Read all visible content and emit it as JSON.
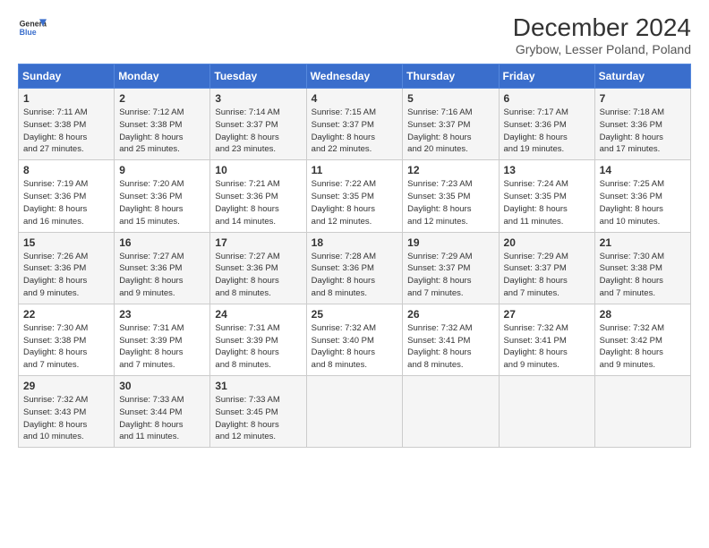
{
  "header": {
    "title": "December 2024",
    "subtitle": "Grybow, Lesser Poland, Poland"
  },
  "days": [
    "Sunday",
    "Monday",
    "Tuesday",
    "Wednesday",
    "Thursday",
    "Friday",
    "Saturday"
  ],
  "weeks": [
    [
      {
        "num": "1",
        "detail": "Sunrise: 7:11 AM\nSunset: 3:38 PM\nDaylight: 8 hours\nand 27 minutes."
      },
      {
        "num": "2",
        "detail": "Sunrise: 7:12 AM\nSunset: 3:38 PM\nDaylight: 8 hours\nand 25 minutes."
      },
      {
        "num": "3",
        "detail": "Sunrise: 7:14 AM\nSunset: 3:37 PM\nDaylight: 8 hours\nand 23 minutes."
      },
      {
        "num": "4",
        "detail": "Sunrise: 7:15 AM\nSunset: 3:37 PM\nDaylight: 8 hours\nand 22 minutes."
      },
      {
        "num": "5",
        "detail": "Sunrise: 7:16 AM\nSunset: 3:37 PM\nDaylight: 8 hours\nand 20 minutes."
      },
      {
        "num": "6",
        "detail": "Sunrise: 7:17 AM\nSunset: 3:36 PM\nDaylight: 8 hours\nand 19 minutes."
      },
      {
        "num": "7",
        "detail": "Sunrise: 7:18 AM\nSunset: 3:36 PM\nDaylight: 8 hours\nand 17 minutes."
      }
    ],
    [
      {
        "num": "8",
        "detail": "Sunrise: 7:19 AM\nSunset: 3:36 PM\nDaylight: 8 hours\nand 16 minutes."
      },
      {
        "num": "9",
        "detail": "Sunrise: 7:20 AM\nSunset: 3:36 PM\nDaylight: 8 hours\nand 15 minutes."
      },
      {
        "num": "10",
        "detail": "Sunrise: 7:21 AM\nSunset: 3:36 PM\nDaylight: 8 hours\nand 14 minutes."
      },
      {
        "num": "11",
        "detail": "Sunrise: 7:22 AM\nSunset: 3:35 PM\nDaylight: 8 hours\nand 12 minutes."
      },
      {
        "num": "12",
        "detail": "Sunrise: 7:23 AM\nSunset: 3:35 PM\nDaylight: 8 hours\nand 12 minutes."
      },
      {
        "num": "13",
        "detail": "Sunrise: 7:24 AM\nSunset: 3:35 PM\nDaylight: 8 hours\nand 11 minutes."
      },
      {
        "num": "14",
        "detail": "Sunrise: 7:25 AM\nSunset: 3:36 PM\nDaylight: 8 hours\nand 10 minutes."
      }
    ],
    [
      {
        "num": "15",
        "detail": "Sunrise: 7:26 AM\nSunset: 3:36 PM\nDaylight: 8 hours\nand 9 minutes."
      },
      {
        "num": "16",
        "detail": "Sunrise: 7:27 AM\nSunset: 3:36 PM\nDaylight: 8 hours\nand 9 minutes."
      },
      {
        "num": "17",
        "detail": "Sunrise: 7:27 AM\nSunset: 3:36 PM\nDaylight: 8 hours\nand 8 minutes."
      },
      {
        "num": "18",
        "detail": "Sunrise: 7:28 AM\nSunset: 3:36 PM\nDaylight: 8 hours\nand 8 minutes."
      },
      {
        "num": "19",
        "detail": "Sunrise: 7:29 AM\nSunset: 3:37 PM\nDaylight: 8 hours\nand 7 minutes."
      },
      {
        "num": "20",
        "detail": "Sunrise: 7:29 AM\nSunset: 3:37 PM\nDaylight: 8 hours\nand 7 minutes."
      },
      {
        "num": "21",
        "detail": "Sunrise: 7:30 AM\nSunset: 3:38 PM\nDaylight: 8 hours\nand 7 minutes."
      }
    ],
    [
      {
        "num": "22",
        "detail": "Sunrise: 7:30 AM\nSunset: 3:38 PM\nDaylight: 8 hours\nand 7 minutes."
      },
      {
        "num": "23",
        "detail": "Sunrise: 7:31 AM\nSunset: 3:39 PM\nDaylight: 8 hours\nand 7 minutes."
      },
      {
        "num": "24",
        "detail": "Sunrise: 7:31 AM\nSunset: 3:39 PM\nDaylight: 8 hours\nand 8 minutes."
      },
      {
        "num": "25",
        "detail": "Sunrise: 7:32 AM\nSunset: 3:40 PM\nDaylight: 8 hours\nand 8 minutes."
      },
      {
        "num": "26",
        "detail": "Sunrise: 7:32 AM\nSunset: 3:41 PM\nDaylight: 8 hours\nand 8 minutes."
      },
      {
        "num": "27",
        "detail": "Sunrise: 7:32 AM\nSunset: 3:41 PM\nDaylight: 8 hours\nand 9 minutes."
      },
      {
        "num": "28",
        "detail": "Sunrise: 7:32 AM\nSunset: 3:42 PM\nDaylight: 8 hours\nand 9 minutes."
      }
    ],
    [
      {
        "num": "29",
        "detail": "Sunrise: 7:32 AM\nSunset: 3:43 PM\nDaylight: 8 hours\nand 10 minutes."
      },
      {
        "num": "30",
        "detail": "Sunrise: 7:33 AM\nSunset: 3:44 PM\nDaylight: 8 hours\nand 11 minutes."
      },
      {
        "num": "31",
        "detail": "Sunrise: 7:33 AM\nSunset: 3:45 PM\nDaylight: 8 hours\nand 12 minutes."
      },
      null,
      null,
      null,
      null
    ]
  ]
}
